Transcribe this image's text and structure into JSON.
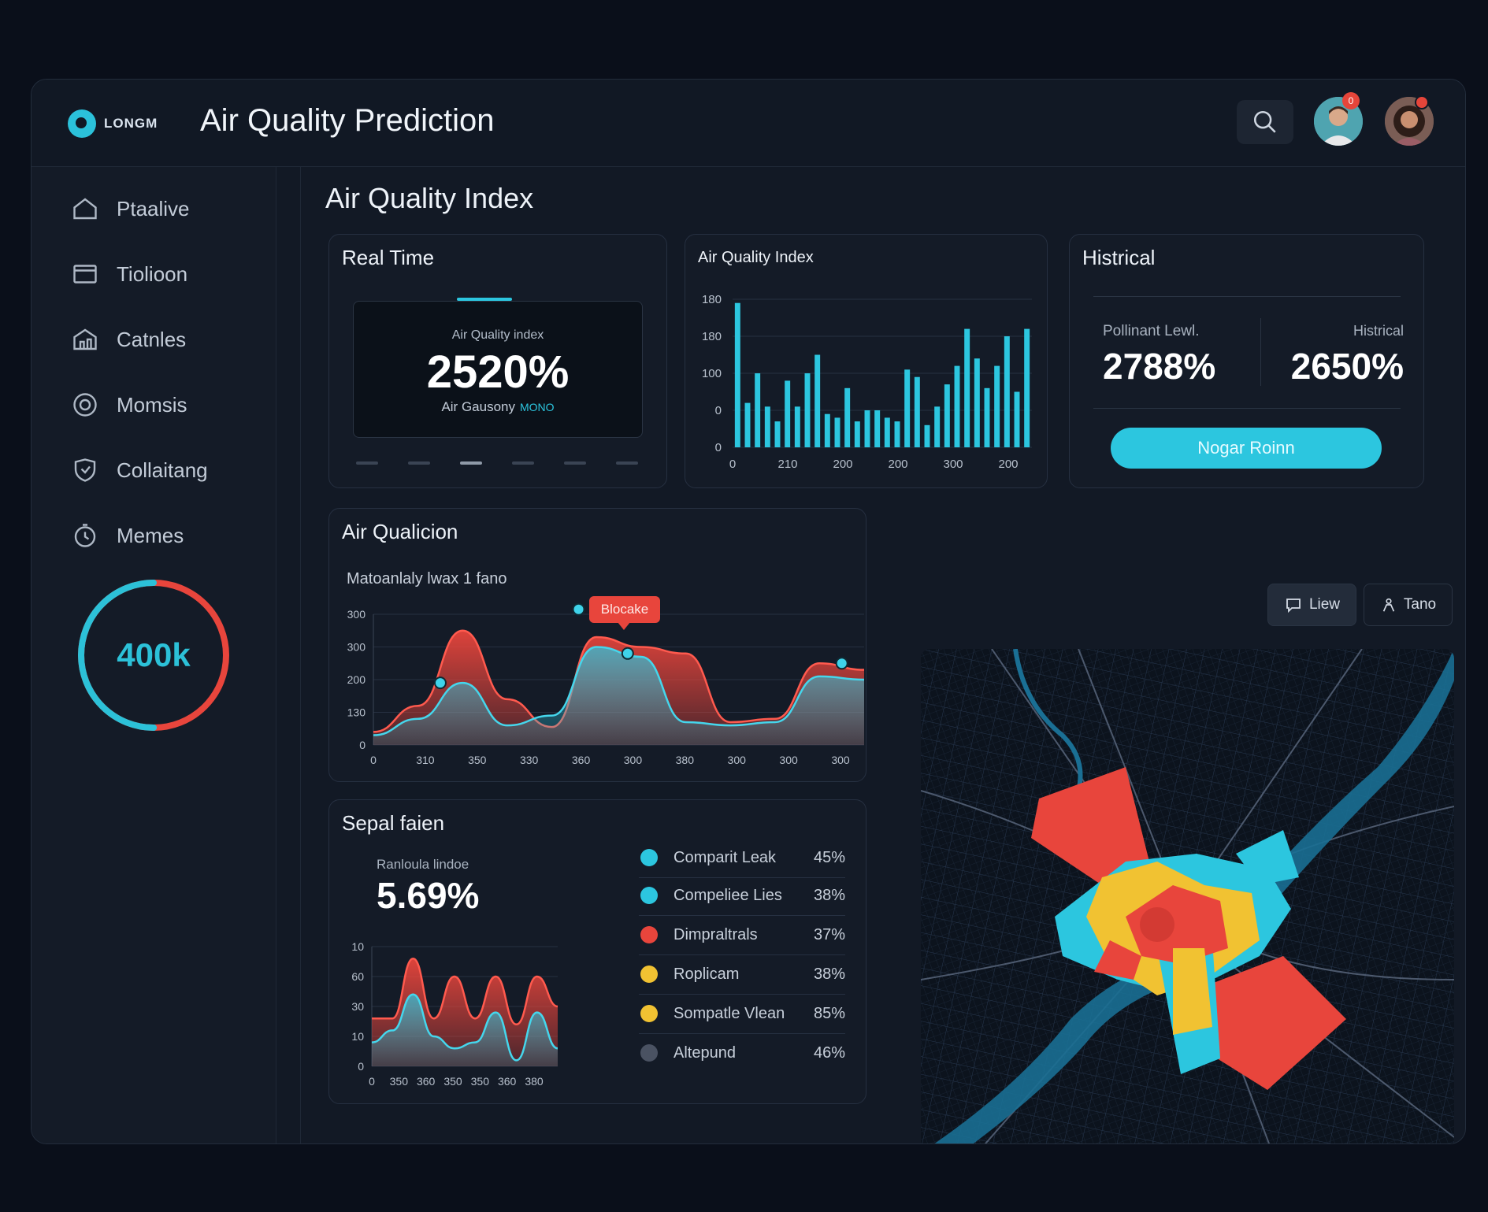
{
  "app": {
    "logo_text": "LONGM",
    "title": "Air Quality Prediction",
    "notification_count": "0"
  },
  "sidebar": {
    "items": [
      {
        "label": "Ptaalive",
        "icon": "home-icon"
      },
      {
        "label": "Tiolioon",
        "icon": "inbox-icon"
      },
      {
        "label": "Catnles",
        "icon": "building-icon"
      },
      {
        "label": "Momsis",
        "icon": "target-icon"
      },
      {
        "label": "Collaitang",
        "icon": "shield-icon"
      },
      {
        "label": "Memes",
        "icon": "timer-icon"
      }
    ],
    "gauge": {
      "label": "400k",
      "fraction": 0.5,
      "colors": {
        "track": "#e8453c",
        "value": "#2cc1d8"
      }
    }
  },
  "main": {
    "page_title": "Air Quality Index",
    "realtime": {
      "title": "Real Time",
      "label": "Air Quality index",
      "value": "2520%",
      "sub_label": "Air Gausony",
      "sub_highlight": "MONO",
      "active_dot": 2,
      "dot_count": 6
    },
    "aqi_chart": {
      "title": "Air Quality Index"
    },
    "historical": {
      "title": "Histrical",
      "left_label": "Pollinant Lewl.",
      "left_value": "2788%",
      "right_label": "Histrical",
      "right_value": "2650%",
      "button_label": "Nogar Roinn"
    },
    "qualicion": {
      "title": "Air Qualicion",
      "subtitle": "Matoanlaly lwax 1 fano",
      "callout": "Blocake"
    },
    "spatial": {
      "title": "Sepal faien",
      "label": "Ranloula lindoe",
      "value": "5.69%",
      "legend": [
        {
          "name": "Comparit Leak",
          "value": "45%",
          "color": "#2cc6df"
        },
        {
          "name": "Compeliee Lies",
          "value": "38%",
          "color": "#2cc6df"
        },
        {
          "name": "Dimpraltrals",
          "value": "37%",
          "color": "#e8453c"
        },
        {
          "name": "Roplicam",
          "value": "38%",
          "color": "#f1c232"
        },
        {
          "name": "Sompatle Vlean",
          "value": "85%",
          "color": "#f1c232"
        },
        {
          "name": "Altepund",
          "value": "46%",
          "color": "#4a5262"
        }
      ]
    },
    "map_tools": {
      "view_label": "Liew",
      "tune_label": "Tano"
    }
  },
  "chart_data": [
    {
      "type": "bar",
      "title": "Air Quality Index",
      "yticks": [
        "0",
        "0",
        "100",
        "180",
        "180"
      ],
      "xticks": [
        "0",
        "210",
        "200",
        "200",
        "300",
        "200"
      ],
      "ylim": [
        0,
        200
      ],
      "values": [
        195,
        60,
        100,
        55,
        35,
        90,
        55,
        100,
        125,
        45,
        40,
        80,
        35,
        50,
        50,
        40,
        35,
        105,
        95,
        30,
        55,
        85,
        110,
        160,
        120,
        80,
        110,
        150,
        75,
        160
      ],
      "color": "#2cc6df",
      "grid": true
    },
    {
      "type": "area",
      "title": "Air Qualicion",
      "yticks": [
        "0",
        "130",
        "200",
        "300",
        "300"
      ],
      "xticks": [
        "0",
        "310",
        "350",
        "330",
        "360",
        "300",
        "380",
        "300",
        "300",
        "300"
      ],
      "ylim": [
        0,
        400
      ],
      "series": [
        {
          "color": "#e8453c",
          "values": [
            40,
            120,
            350,
            140,
            55,
            330,
            300,
            280,
            70,
            80,
            250,
            230
          ]
        },
        {
          "color": "#2cc6df",
          "values": [
            30,
            80,
            190,
            60,
            90,
            300,
            270,
            70,
            60,
            70,
            210,
            200
          ]
        }
      ],
      "markers": [
        [
          1.5,
          190
        ],
        [
          4.6,
          415
        ],
        [
          5.7,
          280
        ],
        [
          10.5,
          250
        ]
      ],
      "grid": true
    },
    {
      "type": "area",
      "title": "Sepal faien",
      "yticks": [
        "0",
        "10",
        "30",
        "60",
        "10"
      ],
      "xticks": [
        "0",
        "350",
        "360",
        "350",
        "350",
        "360",
        "380"
      ],
      "ylim": [
        0,
        100
      ],
      "series": [
        {
          "color": "#e8453c",
          "values": [
            40,
            40,
            90,
            40,
            75,
            40,
            75,
            35,
            75,
            50
          ]
        },
        {
          "color": "#2cc6df",
          "values": [
            20,
            30,
            60,
            25,
            15,
            20,
            45,
            5,
            45,
            15
          ]
        }
      ],
      "grid": true
    }
  ]
}
